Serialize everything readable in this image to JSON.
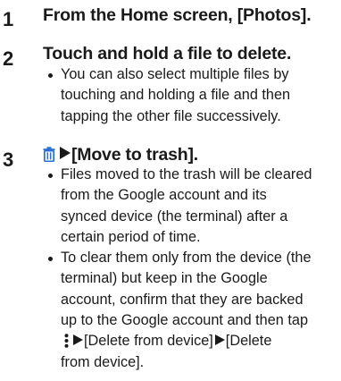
{
  "steps": [
    {
      "number": "1",
      "title": "From the Home screen, [Photos]."
    },
    {
      "number": "2",
      "title": "Touch and hold a file to delete.",
      "bullets": [
        {
          "lines": [
            "You can also select multiple files by",
            "touching and holding a file and then",
            "tapping the other file successively."
          ]
        }
      ]
    },
    {
      "number": "3",
      "title": "[Move to trash].",
      "title_icon": "trash-icon",
      "bullets": [
        {
          "lines": [
            "Files moved to the trash will be cleared",
            "from the Google account and its",
            "synced device (the terminal) after a",
            "certain period of time."
          ]
        },
        {
          "lines": [
            "To clear them only from the device (the",
            "terminal) but keep in the Google",
            "account, confirm that they are backed",
            "up to the Google account and then tap"
          ],
          "menu_line": {
            "icon": "more-vert-icon",
            "action_1": "[Delete from device]",
            "action_2_start": "[Delete"
          },
          "last_line": "from device]."
        }
      ]
    }
  ],
  "colors": {
    "text": "#1a1a1a",
    "accent": "#2a6fd6"
  }
}
